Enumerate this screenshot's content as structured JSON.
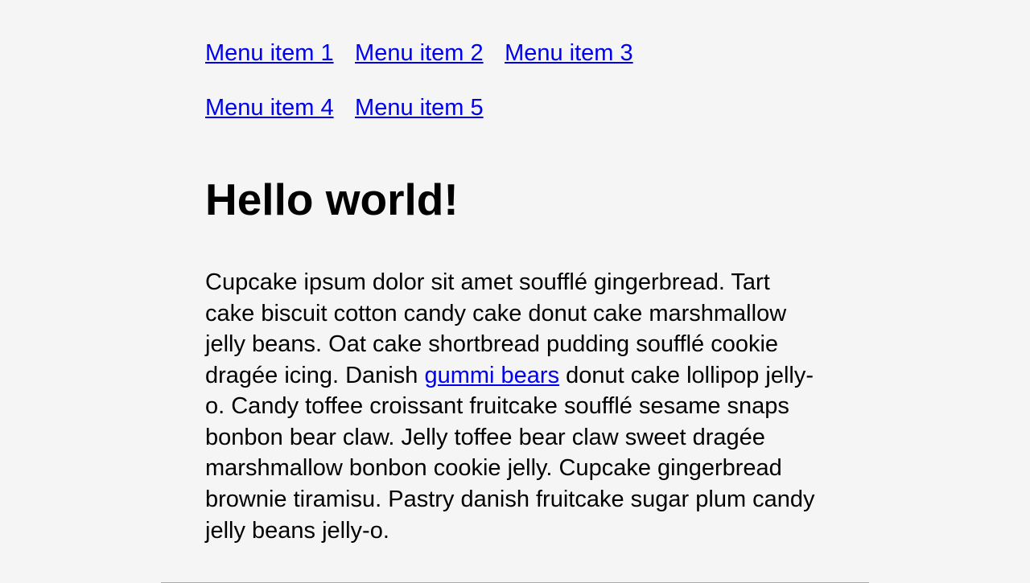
{
  "nav": {
    "items": [
      "Menu item 1",
      "Menu item 2",
      "Menu item 3",
      "Menu item 4",
      "Menu item 5"
    ]
  },
  "heading": "Hello world!",
  "paragraph": {
    "part1": "Cupcake ipsum dolor sit amet soufflé gingerbread. Tart cake biscuit cotton candy cake donut cake marshmallow jelly beans. Oat cake shortbread pudding soufflé cookie dragée icing. Danish ",
    "link": "gummi bears",
    "part2": " donut cake lollipop jelly-o. Candy toffee croissant fruitcake soufflé sesame snaps bonbon bear claw. Jelly toffee bear claw sweet dragée marshmallow bonbon cookie jelly. Cupcake gingerbread brownie tiramisu. Pastry danish fruitcake sugar plum candy jelly beans jelly-o."
  }
}
